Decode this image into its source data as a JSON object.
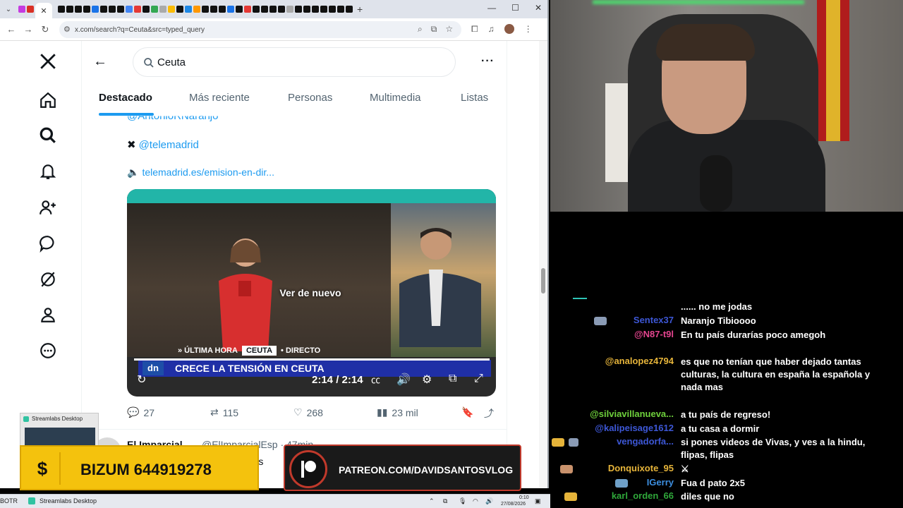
{
  "browser": {
    "url": "x.com/search?q=Ceuta&src=typed_query",
    "window_controls": [
      "—",
      "☐",
      "✕"
    ]
  },
  "x": {
    "search_value": "Ceuta",
    "tabs": [
      "Destacado",
      "Más reciente",
      "Personas",
      "Multimedia",
      "Listas"
    ],
    "active_tab": "Destacado",
    "post": {
      "handle_cut": "@AntonioRNaranjo",
      "mention": "@telemadrid",
      "link": "telemadrid.es/emision-en-dir...",
      "video": {
        "replay_label": "Ver de nuevo",
        "lower_tags": [
          "» ÚLTIMA HORA",
          "CEUTA",
          "• DIRECTO"
        ],
        "headline": "CRECE LA TENSIÓN EN CEUTA",
        "logo": "dn",
        "time": "2:14 / 2:14"
      },
      "replies": "27",
      "reposts": "115",
      "likes": "268",
      "views": "23 mil"
    },
    "next_post": {
      "name": "El Imparcial",
      "handle": "@ElImparcialEsp · 47min",
      "text_fragment": "cadas"
    }
  },
  "overlays": {
    "streamlabs_popup_title": "Streamlabs Desktop",
    "bizum_symbol": "$",
    "bizum": "BIZUM 644919278",
    "patreon": "PATREON.COM/DAVIDSANTOSVLOG"
  },
  "taskbar": {
    "left_cut": "BOTR",
    "app": "Streamlabs Desktop",
    "time": "0:10",
    "date": "27/08/2026"
  },
  "chat": {
    "partial_top": "......  no me jodas",
    "messages": [
      {
        "user": "Sentex37",
        "color": "#3d57d6",
        "text": "Naranjo Tibioooo"
      },
      {
        "user": "@N87-t9l",
        "color": "#e4458f",
        "text": "En tu país durarías poco amegoh"
      },
      {
        "user": "@analopez4794",
        "color": "#e6b43a",
        "text": "es que no tenían que haber dejado tantas culturas, la cultura en españa la española y nada mas"
      },
      {
        "user": "@silviavillanueva...",
        "color": "#6fd13c",
        "text": "a tu país de regreso!"
      },
      {
        "user": "@kalipeisage1612",
        "color": "#3d57d6",
        "text": "a tu casa a dormir"
      },
      {
        "user": "vengadorfa...",
        "color": "#3d57d6",
        "text": "si pones videos de Vivas, y ves a la hindu, flipas, flipas"
      },
      {
        "user": "Donquixote_95",
        "color": "#e6b43a",
        "text": ""
      },
      {
        "user": "IGerry",
        "color": "#3d8fe0",
        "text": "Fua d pato 2x5"
      },
      {
        "user": "karl_orden_66",
        "color": "#2fa83a",
        "text": "diles que no"
      }
    ]
  }
}
